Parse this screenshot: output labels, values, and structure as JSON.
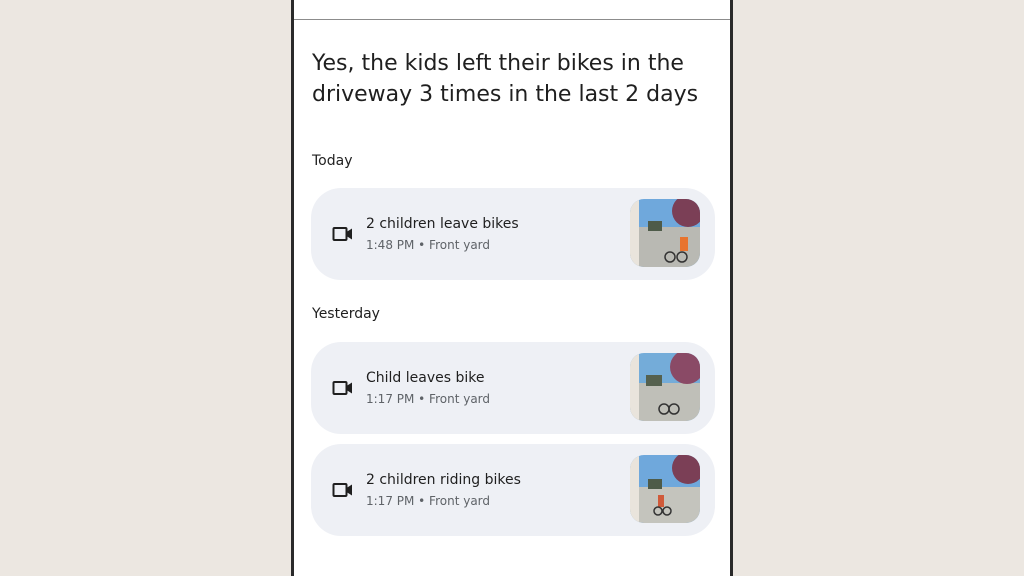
{
  "answer": {
    "text": "Yes, the kids left their bikes in the driveway 3 times in the last 2 days"
  },
  "sections": [
    {
      "label": "Today",
      "events": [
        {
          "title": "2 children leave bikes",
          "time": "1:48 PM",
          "location": "Front yard",
          "icon": "video-camera-icon",
          "meta": "1:48 PM • Front yard"
        }
      ]
    },
    {
      "label": "Yesterday",
      "events": [
        {
          "title": "Child leaves bike",
          "time": "1:17 PM",
          "location": "Front yard",
          "icon": "video-camera-icon",
          "meta": "1:17 PM • Front yard"
        },
        {
          "title": "2 children riding bikes",
          "time": "1:17 PM",
          "location": "Front yard",
          "icon": "video-camera-icon",
          "meta": "1:17 PM • Front yard"
        }
      ]
    }
  ],
  "colors": {
    "page_background": "#ece7e1",
    "card_background": "#eef0f5",
    "text_primary": "#1f1f1f",
    "text_secondary": "#5f6368"
  }
}
